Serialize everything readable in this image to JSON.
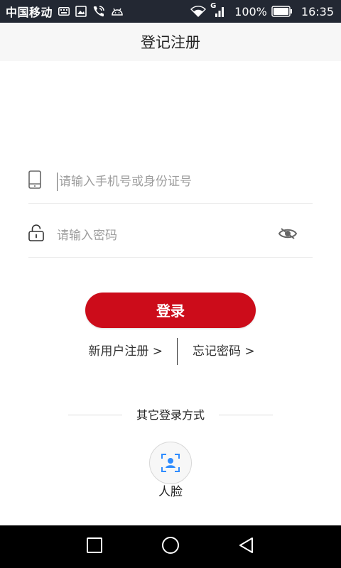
{
  "status_bar": {
    "carrier": "中国移动",
    "battery": "100%",
    "time": "16:35",
    "signal_badge": "G",
    "icons": [
      "keyboard-icon",
      "image-icon",
      "phone-wifi-icon",
      "android-icon",
      "wifi-icon",
      "signal-icon",
      "battery-icon"
    ]
  },
  "header": {
    "title": "登记注册"
  },
  "form": {
    "phone": {
      "icon": "mobile-phone-icon",
      "placeholder": "请输入手机号或身份证号",
      "value": ""
    },
    "password": {
      "icon": "lock-icon",
      "placeholder": "请输入密码",
      "value": "",
      "toggle_icon": "eye-hidden-icon"
    },
    "login_label": "登录"
  },
  "links": {
    "register": "新用户注册 >",
    "forgot": "忘记密码 >"
  },
  "other_login": {
    "label": "其它登录方式",
    "face": {
      "icon": "face-scan-icon",
      "label": "人脸"
    }
  },
  "nav": {
    "icons": [
      "recent-apps-icon",
      "home-icon",
      "back-icon"
    ]
  },
  "colors": {
    "accent": "#cc0c1a",
    "status_bar": "#232833",
    "header_bg": "#f7f7f7",
    "face_icon": "#2f8cff"
  }
}
